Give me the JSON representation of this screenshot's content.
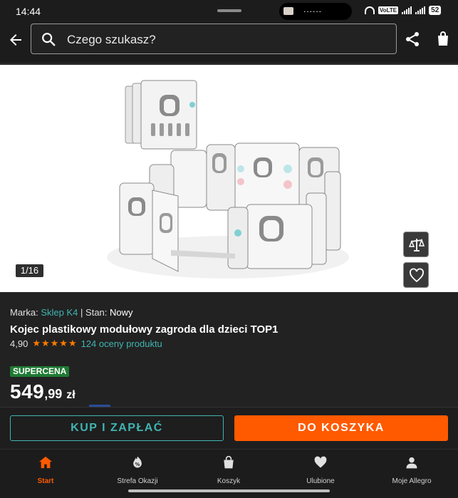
{
  "status_bar": {
    "time": "14:44",
    "notification_text": "......",
    "network_badge": "VoLTE",
    "battery": "52"
  },
  "search": {
    "placeholder": "Czego szukasz?"
  },
  "gallery": {
    "counter": "1/16"
  },
  "product": {
    "brand_label": "Marka:",
    "brand_value": "Sklep K4",
    "separator": "|",
    "condition_label": "Stan:",
    "condition_value": "Nowy",
    "title": "Kojec plastikowy modułowy zagroda dla dzieci TOP1",
    "rating_value": "4,90",
    "rating_stars": 5,
    "reviews_text": "124 oceny produktu",
    "badge": "SUPERCENA",
    "price_main": "549",
    "price_decimal": ",99",
    "price_currency": "zł"
  },
  "actions": {
    "buy_now_label": "KUP I ZAPŁAĆ",
    "add_to_cart_label": "DO KOSZYKA"
  },
  "nav": {
    "items": [
      {
        "label": "Start",
        "icon": "home-icon",
        "active": true
      },
      {
        "label": "Strefa Okazji",
        "icon": "deals-icon",
        "active": false
      },
      {
        "label": "Koszyk",
        "icon": "cart-icon",
        "active": false
      },
      {
        "label": "Ulubione",
        "icon": "heart-icon",
        "active": false
      },
      {
        "label": "Moje Allegro",
        "icon": "user-icon",
        "active": false
      }
    ]
  },
  "colors": {
    "accent_orange": "#ff5a00",
    "accent_teal": "#3fb5b2",
    "supercena_green": "#1f7a33",
    "background": "#222222"
  }
}
